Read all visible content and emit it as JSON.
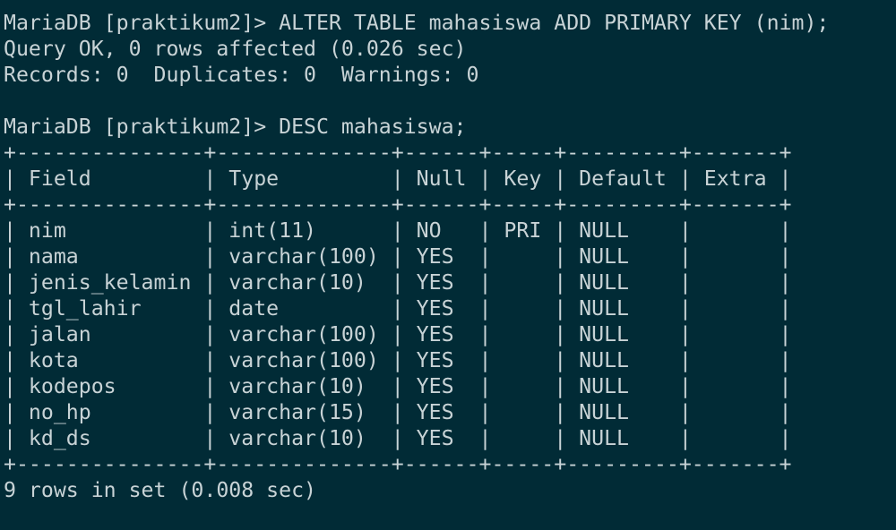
{
  "terminal": {
    "lines": [
      "MariaDB [praktikum2]> ALTER TABLE mahasiswa ADD PRIMARY KEY (nim);",
      "Query OK, 0 rows affected (0.026 sec)",
      "Records: 0  Duplicates: 0  Warnings: 0",
      "",
      "MariaDB [praktikum2]> DESC mahasiswa;",
      "+---------------+--------------+------+-----+---------+-------+",
      "| Field         | Type         | Null | Key | Default | Extra |",
      "+---------------+--------------+------+-----+---------+-------+",
      "| nim           | int(11)      | NO   | PRI | NULL    |       |",
      "| nama          | varchar(100) | YES  |     | NULL    |       |",
      "| jenis_kelamin | varchar(10)  | YES  |     | NULL    |       |",
      "| tgl_lahir     | date         | YES  |     | NULL    |       |",
      "| jalan         | varchar(100) | YES  |     | NULL    |       |",
      "| kota          | varchar(100) | YES  |     | NULL    |       |",
      "| kodepos       | varchar(10)  | YES  |     | NULL    |       |",
      "| no_hp         | varchar(15)  | YES  |     | NULL    |       |",
      "| kd_ds         | varchar(10)  | YES  |     | NULL    |       |",
      "+---------------+--------------+------+-----+---------+-------+",
      "9 rows in set (0.008 sec)"
    ]
  },
  "colors": {
    "background": "#012b36",
    "text": "#c8d3d6"
  }
}
